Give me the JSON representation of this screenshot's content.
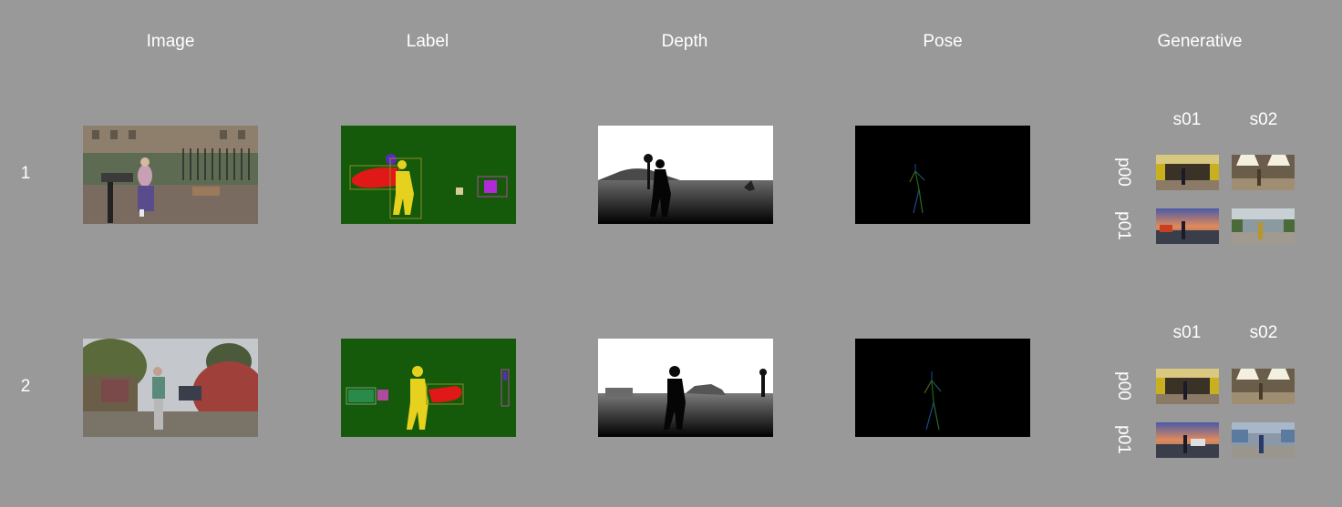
{
  "headers": {
    "image": "Image",
    "label": "Label",
    "depth": "Depth",
    "pose": "Pose",
    "generative": "Generative"
  },
  "rows": [
    {
      "index": "1",
      "style_labels": [
        "s01",
        "s02"
      ],
      "prompt_labels": [
        "p00",
        "p01"
      ]
    },
    {
      "index": "2",
      "style_labels": [
        "s01",
        "s02"
      ],
      "prompt_labels": [
        "p00",
        "p01"
      ]
    }
  ],
  "colors": {
    "background": "#999999",
    "label_background": "#145a0a",
    "label_person": "#e6d21e",
    "label_vehicle": "#e01818",
    "label_sign": "#8a2be2",
    "depth_far": "#ffffff",
    "depth_near": "#000000",
    "pose_background": "#000000"
  }
}
